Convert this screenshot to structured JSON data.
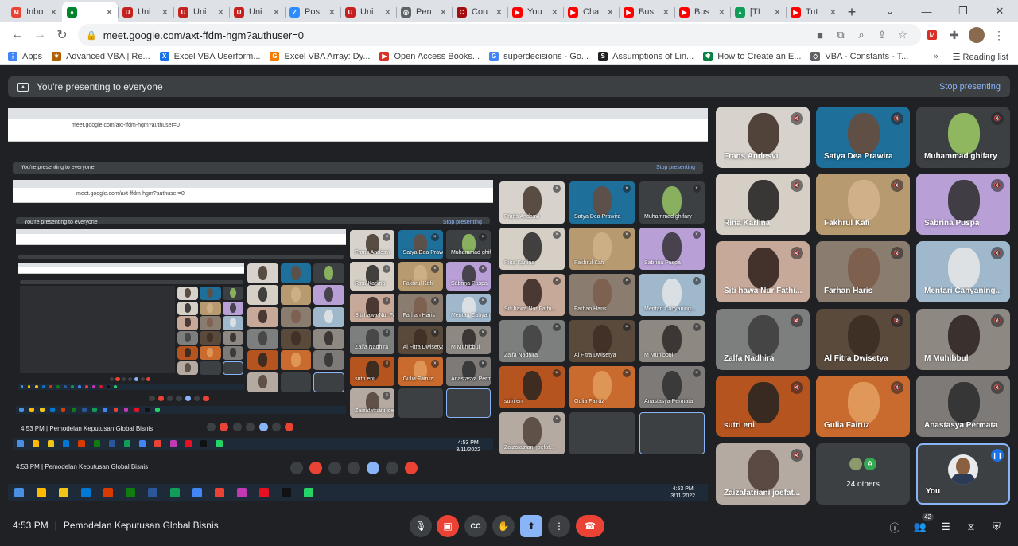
{
  "browser": {
    "tabs": [
      {
        "label": "Inbo",
        "color": "#ea4335",
        "glyph": "M",
        "active": false
      },
      {
        "label": "",
        "color": "#00832d",
        "glyph": "●",
        "active": true
      },
      {
        "label": "Uni",
        "color": "#c5221f",
        "glyph": "U",
        "active": false
      },
      {
        "label": "Uni",
        "color": "#c5221f",
        "glyph": "U",
        "active": false
      },
      {
        "label": "Uni",
        "color": "#c5221f",
        "glyph": "U",
        "active": false
      },
      {
        "label": "Pos",
        "color": "#2d8cff",
        "glyph": "Z",
        "active": false
      },
      {
        "label": "Uni",
        "color": "#c5221f",
        "glyph": "U",
        "active": false
      },
      {
        "label": "Pen",
        "color": "#5f6368",
        "glyph": "◎",
        "active": false
      },
      {
        "label": "Cou",
        "color": "#a50e0e",
        "glyph": "C",
        "active": false
      },
      {
        "label": "You",
        "color": "#ff0000",
        "glyph": "▶",
        "active": false
      },
      {
        "label": "Cha",
        "color": "#ff0000",
        "glyph": "▶",
        "active": false
      },
      {
        "label": "Bus",
        "color": "#ff0000",
        "glyph": "▶",
        "active": false
      },
      {
        "label": "Bus",
        "color": "#ff0000",
        "glyph": "▶",
        "active": false
      },
      {
        "label": "[TI",
        "color": "#0f9d58",
        "glyph": "▲",
        "active": false
      },
      {
        "label": "Tut",
        "color": "#ff0000",
        "glyph": "▶",
        "active": false
      }
    ],
    "url": "meet.google.com/axt-ffdm-hgm?authuser=0",
    "bookmarks": [
      {
        "label": "Apps",
        "color": "#4285f4",
        "glyph": "⋮"
      },
      {
        "label": "Advanced VBA | Re...",
        "color": "#b06000",
        "glyph": "✶"
      },
      {
        "label": "Excel VBA Userform...",
        "color": "#1a73e8",
        "glyph": "X"
      },
      {
        "label": "Excel VBA Array: Dy...",
        "color": "#f57c00",
        "glyph": "G"
      },
      {
        "label": "Open Access Books...",
        "color": "#d93025",
        "glyph": "▶"
      },
      {
        "label": "superdecisions - Go...",
        "color": "#4285f4",
        "glyph": "G"
      },
      {
        "label": "Assumptions of Lin...",
        "color": "#202124",
        "glyph": "S"
      },
      {
        "label": "How to Create an E...",
        "color": "#0b8043",
        "glyph": "✱"
      },
      {
        "label": "VBA - Constants - T...",
        "color": "#5f6368",
        "glyph": "◇"
      }
    ],
    "reading_list": "Reading list"
  },
  "banner": {
    "text": "You're presenting to everyone",
    "stop": "Stop presenting"
  },
  "participants": [
    {
      "name": "Frans Andesvi",
      "bg": "#d8d2cc",
      "face": "#3a2a20"
    },
    {
      "name": "Satya Dea Prawira",
      "bg": "#1e6f9a",
      "face": "#6b4a36"
    },
    {
      "name": "Muhammad ghifary",
      "bg": "#3c4043",
      "face": "#9ccc65"
    },
    {
      "name": "Rina Karlina",
      "bg": "#d5cfc6",
      "face": "#1c1c1c"
    },
    {
      "name": "Fakhrul Kafi",
      "bg": "#b89a70",
      "face": "#d2b48c"
    },
    {
      "name": "Sabrina Puspa",
      "bg": "#b89fd6",
      "face": "#2b2b2b"
    },
    {
      "name": "Siti hawa Nur Fathi...",
      "bg": "#c7a99a",
      "face": "#2a1d18"
    },
    {
      "name": "Farhan Haris",
      "bg": "#8a7d70",
      "face": "#7a5a48"
    },
    {
      "name": "Mentari Cahyaning...",
      "bg": "#9fb8cc",
      "face": "#e8e8e8"
    },
    {
      "name": "Zalfa Nadhira",
      "bg": "#7d7f7e",
      "face": "#3b3b3b"
    },
    {
      "name": "Al Fitra Dwisetya",
      "bg": "#5a4a3c",
      "face": "#3b2b22"
    },
    {
      "name": "M Muhibbul",
      "bg": "#8e8882",
      "face": "#2b2220"
    },
    {
      "name": "sutri eni",
      "bg": "#b5541f",
      "face": "#222222"
    },
    {
      "name": "Gulia Fairuz",
      "bg": "#c96a2e",
      "face": "#e3a060"
    },
    {
      "name": "Anastasya Permata",
      "bg": "#7d7a78",
      "face": "#2a2a2a"
    },
    {
      "name": "Zaizafatriani joefat...",
      "bg": "#b5aaa2",
      "face": "#4a3a32"
    }
  ],
  "others": {
    "label": "24 others",
    "initial": "A"
  },
  "you": {
    "label": "You"
  },
  "time_meeting": {
    "time": "4:53 PM",
    "separator": "|",
    "title": "Pemodelan Keputusan Global Bisnis"
  },
  "people_count": "42",
  "taskbar": {
    "time": "4:53 PM",
    "date": "3/11/2022"
  }
}
